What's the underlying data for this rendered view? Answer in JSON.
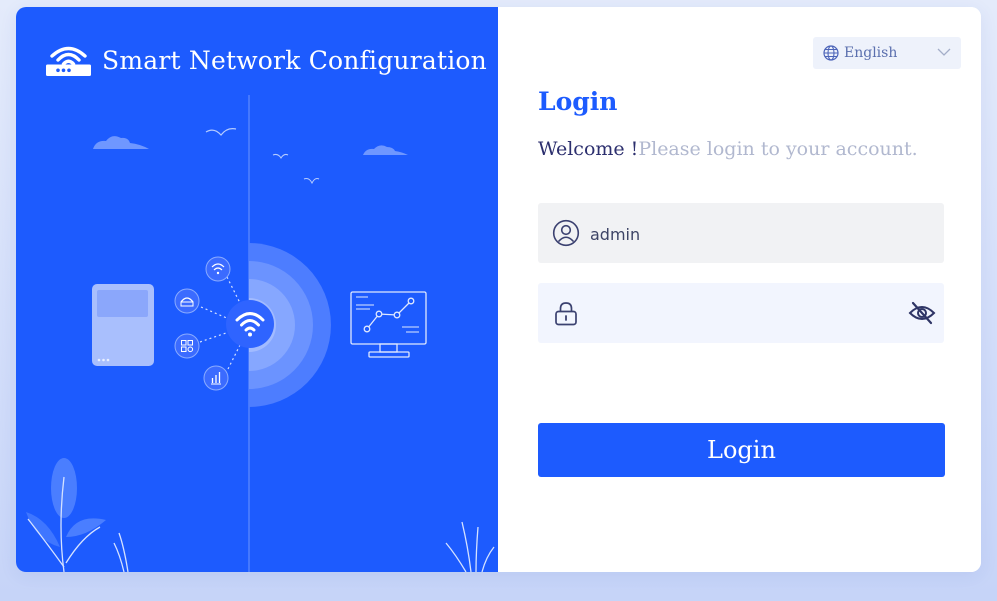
{
  "app": {
    "title": "Smart Network Configuration"
  },
  "language": {
    "selected": "English"
  },
  "login": {
    "heading": "Login",
    "welcome": "Welcome !",
    "subtitle": "Please login to your account.",
    "username_value": "admin",
    "password_value": "",
    "button_label": "Login"
  },
  "colors": {
    "primary": "#1d5bfe",
    "background": "#dbe4fb",
    "heading_text": "#2c2f6e",
    "muted_text": "#b1b8cf"
  },
  "icons": {
    "logo": "router-wifi-logo",
    "language": "globe-icon",
    "username": "user-icon",
    "password": "lock-icon",
    "toggle_password": "eye-off-icon"
  }
}
